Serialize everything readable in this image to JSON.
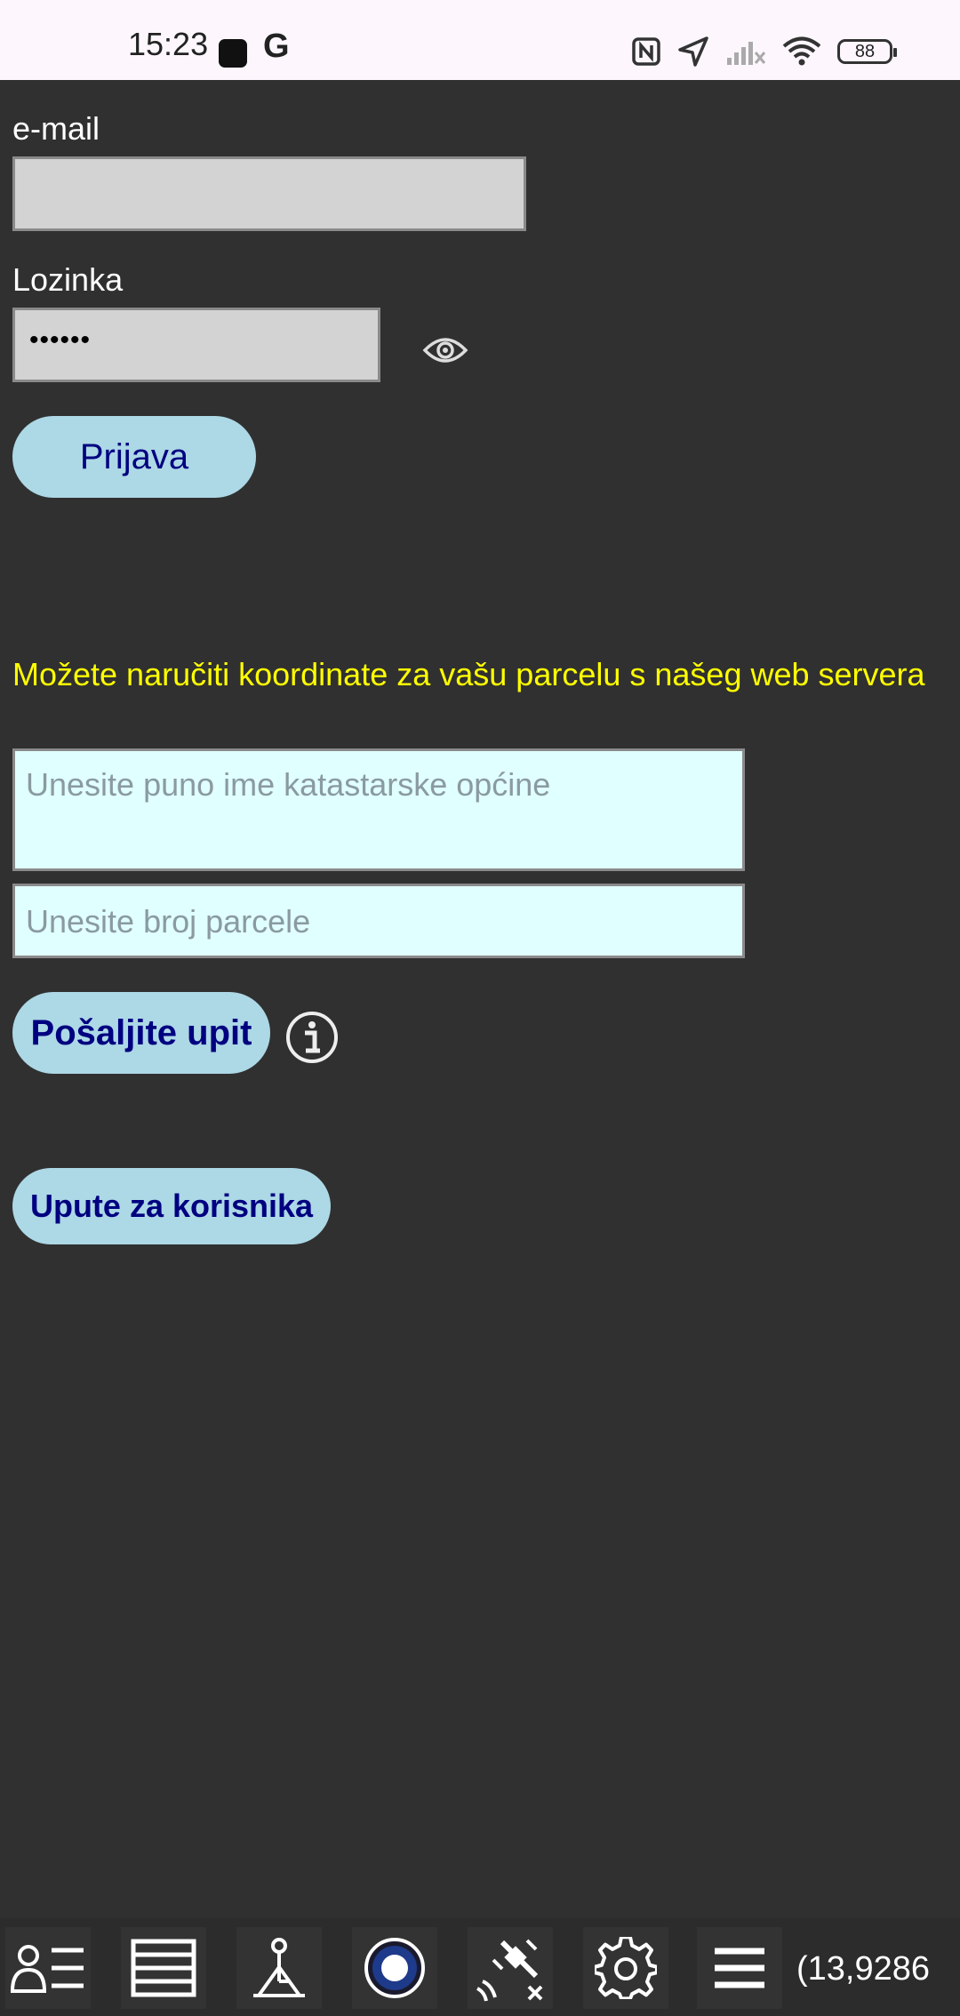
{
  "status_bar": {
    "time": "15:23",
    "battery": "88",
    "icons": [
      "notification-square-icon",
      "google-icon",
      "nfc-icon",
      "location-arrow-icon",
      "cellular-no-signal-icon",
      "wifi-icon",
      "battery-icon"
    ]
  },
  "login": {
    "email_label": "e-mail",
    "email_value": "",
    "password_label": "Lozinka",
    "password_value": "••••••",
    "login_button": "Prijava"
  },
  "order": {
    "notice": "Možete naručiti koordinate za vašu parcelu s našeg web servera",
    "municipality_placeholder": "Unesite puno ime katastarske općine",
    "parcel_placeholder": "Unesite broj parcele",
    "send_button": "Pošaljite upit"
  },
  "manual_button": "Upute za korisnika",
  "toolbar": {
    "coordinate": "(13,9286",
    "icons": [
      "user-list-icon",
      "layers-icon",
      "survey-point-icon",
      "record-icon",
      "satellite-icon",
      "gear-icon",
      "menu-icon"
    ]
  },
  "colors": {
    "background": "#303030",
    "notice": "#ffff00",
    "button_bg": "#add8e6",
    "button_text": "#000080",
    "input_gray": "#d3d3d3",
    "input_cyan": "#e0ffff"
  }
}
